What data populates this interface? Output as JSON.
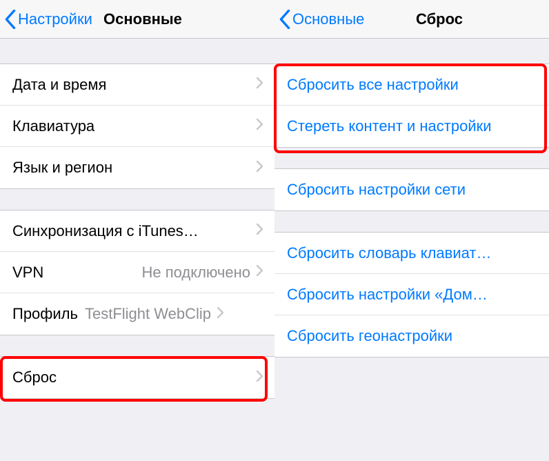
{
  "left": {
    "back_label": "Настройки",
    "title": "Основные",
    "group1": [
      {
        "label": "Дата и время"
      },
      {
        "label": "Клавиатура"
      },
      {
        "label": "Язык и регион"
      }
    ],
    "group2": [
      {
        "label": "Синхронизация с iTunes…"
      },
      {
        "label": "VPN",
        "value": "Не подключено"
      },
      {
        "label": "Профиль",
        "value": "TestFlight WebClip"
      }
    ],
    "group3": [
      {
        "label": "Сброс"
      }
    ]
  },
  "right": {
    "back_label": "Основные",
    "title": "Сброс",
    "group1": [
      {
        "label": "Сбросить все настройки"
      },
      {
        "label": "Стереть контент и настройки"
      }
    ],
    "group2": [
      {
        "label": "Сбросить настройки сети"
      }
    ],
    "group3": [
      {
        "label": "Сбросить словарь клавиат…"
      },
      {
        "label": "Сбросить настройки «Дом…"
      },
      {
        "label": "Сбросить геонастройки"
      }
    ]
  }
}
